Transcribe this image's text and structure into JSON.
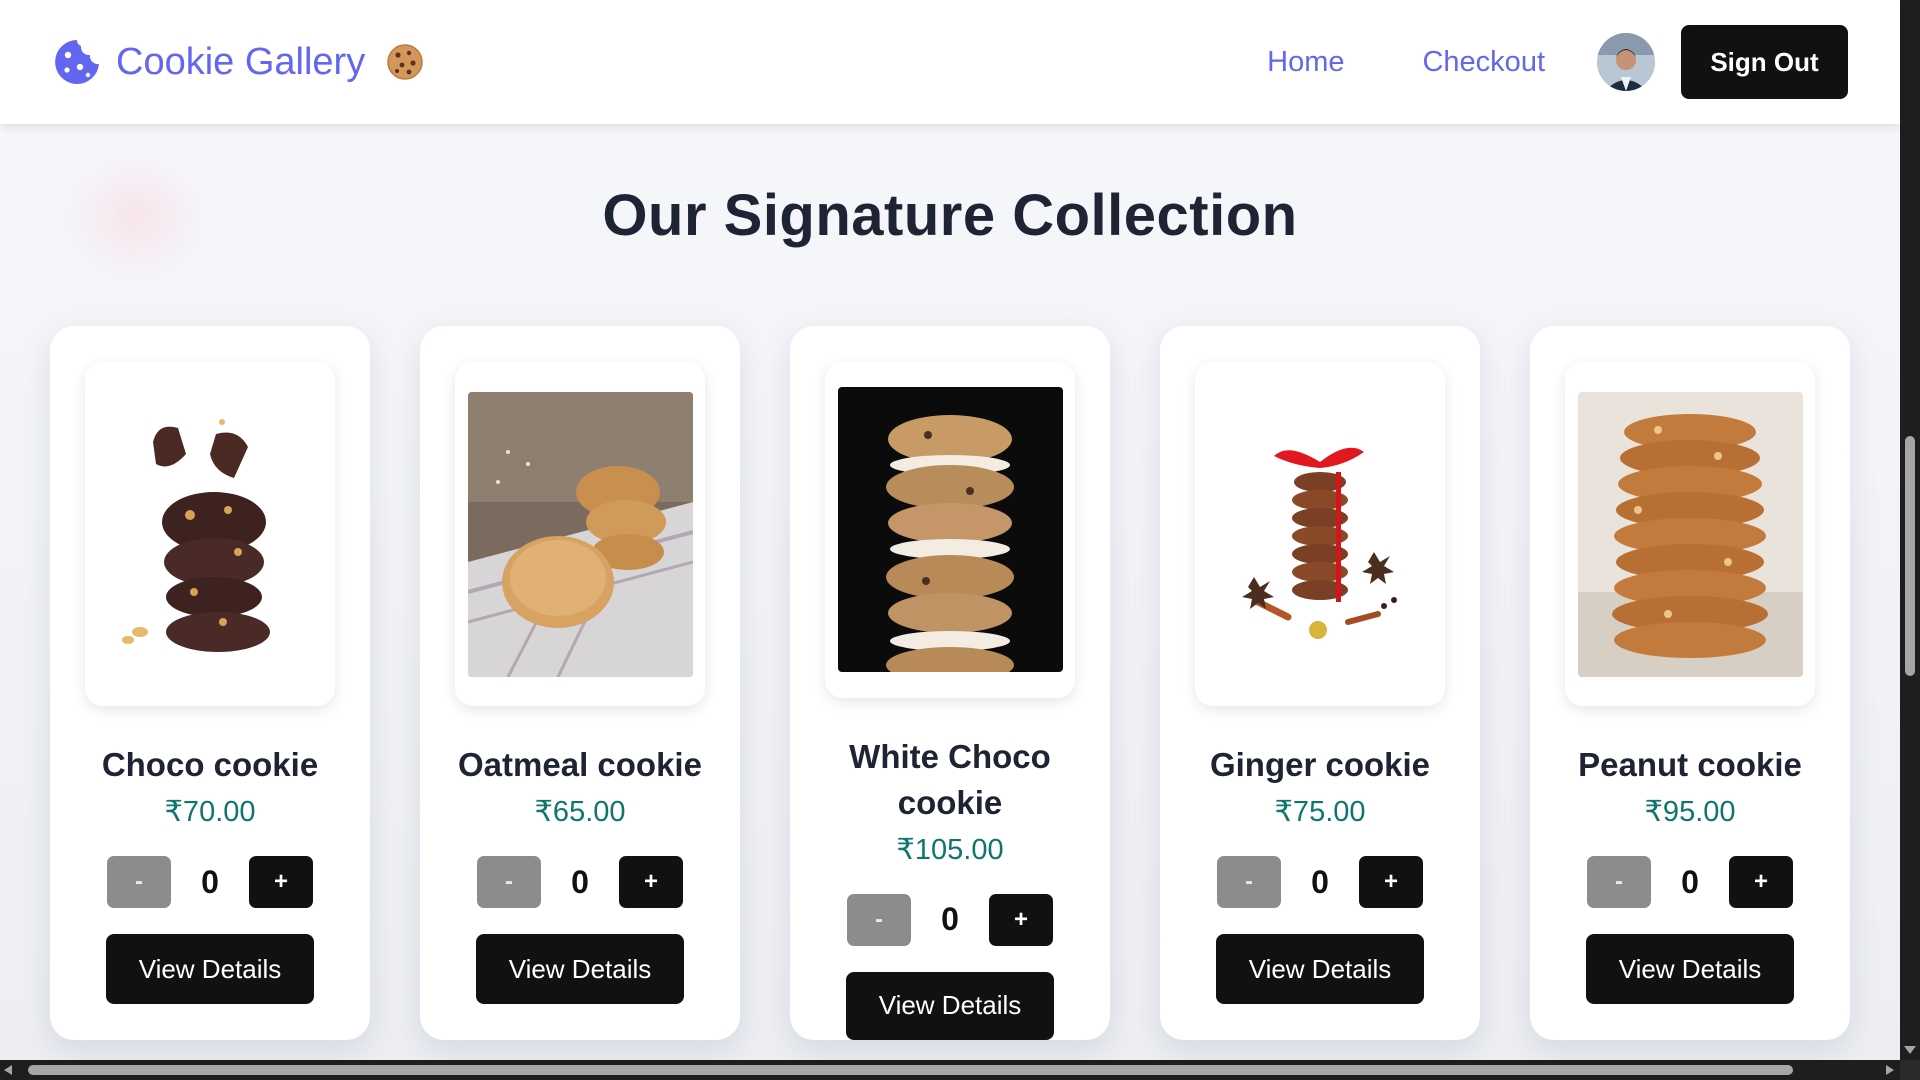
{
  "header": {
    "brand_name": "Cookie Gallery",
    "brand_logo_icon": "cookie-bite-icon",
    "brand_emoji": "🍪",
    "nav": [
      {
        "label": "Home"
      },
      {
        "label": "Checkout"
      }
    ],
    "avatar_icon": "user-avatar",
    "sign_out_label": "Sign Out"
  },
  "section_title": "Our Signature Collection",
  "colors": {
    "brand": "#6366f1",
    "price": "#0f766e",
    "dark_button": "#111111",
    "minus_button": "#8c8c8c"
  },
  "products": [
    {
      "name": "Choco cookie",
      "price": "₹70.00",
      "quantity": "0",
      "minus": "-",
      "plus": "+",
      "details_label": "View Details",
      "image_icon": "choco-cookie-image"
    },
    {
      "name": "Oatmeal cookie",
      "price": "₹65.00",
      "quantity": "0",
      "minus": "-",
      "plus": "+",
      "details_label": "View Details",
      "image_icon": "oatmeal-cookie-image"
    },
    {
      "name": "White Choco cookie",
      "price": "₹105.00",
      "quantity": "0",
      "minus": "-",
      "plus": "+",
      "details_label": "View Details",
      "image_icon": "white-choco-cookie-image"
    },
    {
      "name": "Ginger cookie",
      "price": "₹75.00",
      "quantity": "0",
      "minus": "-",
      "plus": "+",
      "details_label": "View Details",
      "image_icon": "ginger-cookie-image"
    },
    {
      "name": "Peanut cookie",
      "price": "₹95.00",
      "quantity": "0",
      "minus": "-",
      "plus": "+",
      "details_label": "View Details",
      "image_icon": "peanut-cookie-image"
    }
  ]
}
